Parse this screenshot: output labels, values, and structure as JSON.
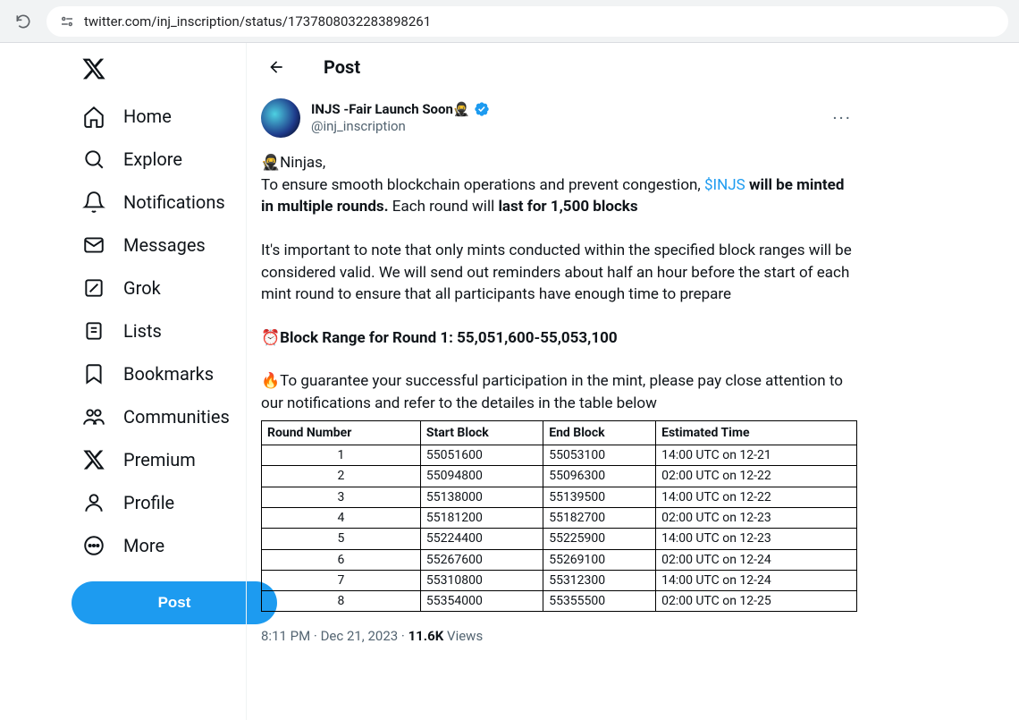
{
  "browser": {
    "url": "twitter.com/inj_inscription/status/1737808032283898261"
  },
  "sidebar": {
    "items": [
      {
        "label": "Home",
        "icon": "home"
      },
      {
        "label": "Explore",
        "icon": "search"
      },
      {
        "label": "Notifications",
        "icon": "bell"
      },
      {
        "label": "Messages",
        "icon": "mail"
      },
      {
        "label": "Grok",
        "icon": "grok"
      },
      {
        "label": "Lists",
        "icon": "list"
      },
      {
        "label": "Bookmarks",
        "icon": "bookmark"
      },
      {
        "label": "Communities",
        "icon": "people"
      },
      {
        "label": "Premium",
        "icon": "x"
      },
      {
        "label": "Profile",
        "icon": "profile"
      },
      {
        "label": "More",
        "icon": "more"
      }
    ],
    "post_button": "Post"
  },
  "header": {
    "title": "Post"
  },
  "post": {
    "author_name": "INJS -Fair Launch Soon🥷",
    "author_handle": "@inj_inscription",
    "body": {
      "line1_prefix": "🥷Ninjas,",
      "line1_text": "To ensure smooth blockchain operations and prevent congestion, ",
      "ticker": "$INJS",
      "line1_bold": " will be minted in multiple rounds.",
      "line1_mid": " Each round will ",
      "line1_bold2": "last for 1,500 blocks",
      "line2": "It's important to note that only mints conducted within the specified block ranges will be considered valid. We will send out reminders about half an hour before the start of each mint round to ensure that all participants have enough time to prepare",
      "line3": "⏰Block Range for Round 1: 55,051,600-55,053,100",
      "line4": "🔥To guarantee your successful participation in the mint, please pay close attention to our notifications and refer to the detailes in the table below"
    },
    "table": {
      "headers": [
        "Round Number",
        "Start Block",
        "End Block",
        "Estimated Time"
      ],
      "rows": [
        [
          "1",
          "55051600",
          "55053100",
          "14:00 UTC on 12-21"
        ],
        [
          "2",
          "55094800",
          "55096300",
          "02:00 UTC on 12-22"
        ],
        [
          "3",
          "55138000",
          "55139500",
          "14:00 UTC on 12-22"
        ],
        [
          "4",
          "55181200",
          "55182700",
          "02:00 UTC on 12-23"
        ],
        [
          "5",
          "55224400",
          "55225900",
          "14:00 UTC on 12-23"
        ],
        [
          "6",
          "55267600",
          "55269100",
          "02:00 UTC on 12-24"
        ],
        [
          "7",
          "55310800",
          "55312300",
          "14:00 UTC on 12-24"
        ],
        [
          "8",
          "55354000",
          "55355500",
          "02:00 UTC on 12-25"
        ]
      ]
    },
    "meta": {
      "time": "8:11 PM",
      "date": "Dec 21, 2023",
      "views_count": "11.6K",
      "views_label": "Views"
    }
  },
  "chart_data": {
    "type": "table",
    "title": "Mint Rounds",
    "columns": [
      "Round Number",
      "Start Block",
      "End Block",
      "Estimated Time"
    ],
    "rows": [
      [
        1,
        55051600,
        55053100,
        "14:00 UTC on 12-21"
      ],
      [
        2,
        55094800,
        55096300,
        "02:00 UTC on 12-22"
      ],
      [
        3,
        55138000,
        55139500,
        "14:00 UTC on 12-22"
      ],
      [
        4,
        55181200,
        55182700,
        "02:00 UTC on 12-23"
      ],
      [
        5,
        55224400,
        55225900,
        "14:00 UTC on 12-23"
      ],
      [
        6,
        55267600,
        55269100,
        "02:00 UTC on 12-24"
      ],
      [
        7,
        55310800,
        55312300,
        "14:00 UTC on 12-24"
      ],
      [
        8,
        55354000,
        55355500,
        "02:00 UTC on 12-25"
      ]
    ]
  }
}
